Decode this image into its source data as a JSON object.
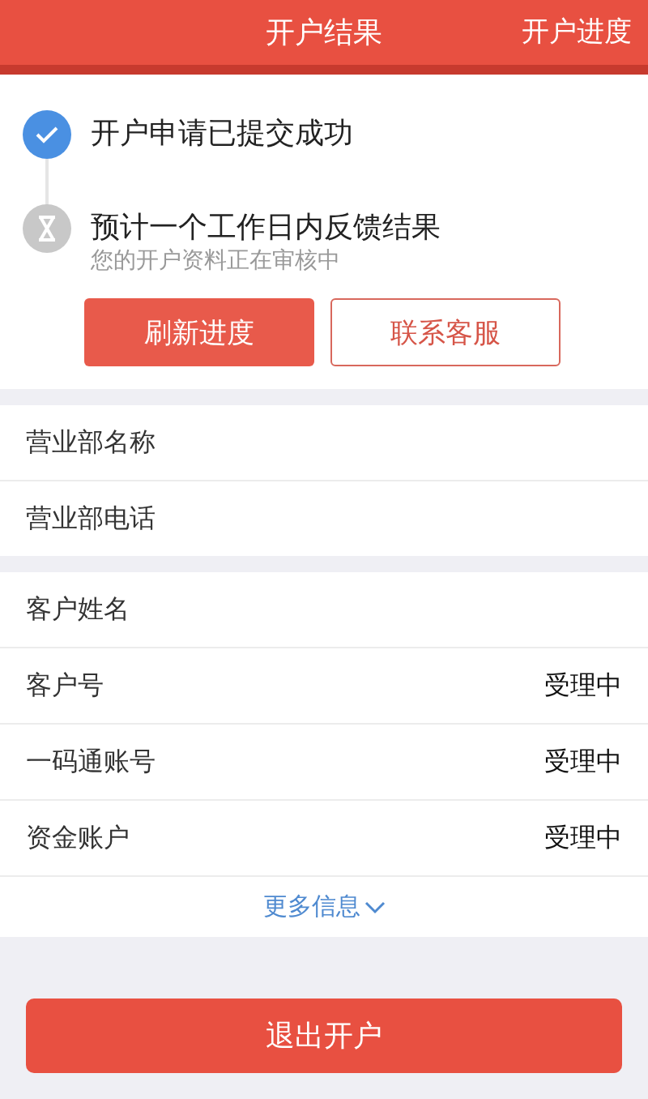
{
  "header": {
    "title": "开户结果",
    "action": "开户进度"
  },
  "steps": [
    {
      "title": "开户申请已提交成功",
      "done": true
    },
    {
      "title": "预计一个工作日内反馈结果",
      "subtitle": "您的开户资料正在审核中",
      "done": false
    }
  ],
  "step_buttons": [
    {
      "label": "刷新进度",
      "kind": "primary"
    },
    {
      "label": "联系客服",
      "kind": "outline"
    }
  ],
  "branch_rows": [
    {
      "label": "营业部名称"
    },
    {
      "label": "营业部电话"
    }
  ],
  "customer_rows": [
    {
      "label": "客户姓名"
    },
    {
      "label": "客户号",
      "value": "受理中"
    },
    {
      "label": "一码通账号",
      "value": "受理中"
    },
    {
      "label": "资金账户",
      "value": "受理中"
    }
  ],
  "more_link": "更多信息",
  "exit_button": "退出开户"
}
